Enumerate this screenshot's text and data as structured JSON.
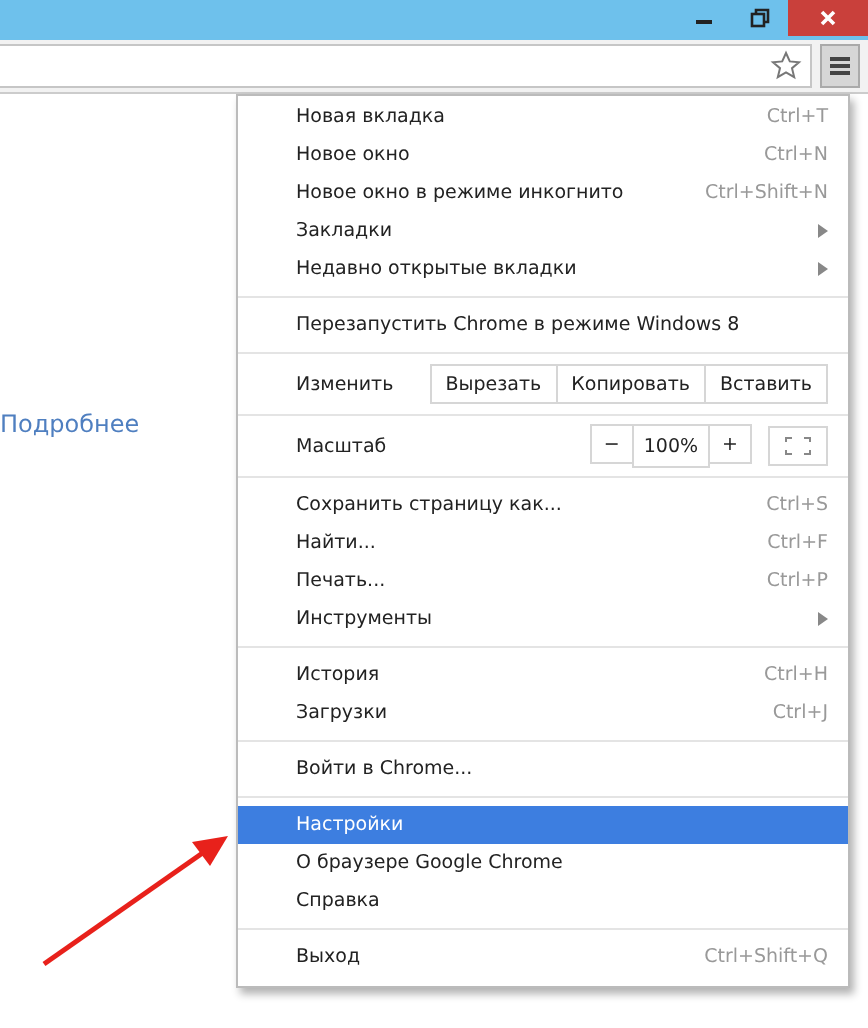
{
  "page": {
    "link": "Подробнее"
  },
  "menu": {
    "sections": [
      [
        {
          "kind": "item",
          "label": "Новая вкладка",
          "shortcut": "Ctrl+T",
          "submenu": false,
          "selected": false
        },
        {
          "kind": "item",
          "label": "Новое окно",
          "shortcut": "Ctrl+N",
          "submenu": false,
          "selected": false
        },
        {
          "kind": "item",
          "label": "Новое окно в режиме инкогнито",
          "shortcut": "Ctrl+Shift+N",
          "submenu": false,
          "selected": false
        },
        {
          "kind": "item",
          "label": "Закладки",
          "submenu": true,
          "selected": false
        },
        {
          "kind": "item",
          "label": "Недавно открытые вкладки",
          "submenu": true,
          "selected": false
        }
      ],
      [
        {
          "kind": "item",
          "label": "Перезапустить Chrome в режиме Windows 8",
          "submenu": false,
          "selected": false
        }
      ],
      [
        {
          "kind": "edit",
          "label": "Изменить",
          "buttons": [
            "Вырезать",
            "Копировать",
            "Вставить"
          ]
        }
      ],
      [
        {
          "kind": "zoom",
          "label": "Масштаб",
          "minus": "−",
          "value": "100%",
          "plus": "+"
        }
      ],
      [
        {
          "kind": "item",
          "label": "Сохранить страницу как...",
          "shortcut": "Ctrl+S",
          "submenu": false,
          "selected": false
        },
        {
          "kind": "item",
          "label": "Найти...",
          "shortcut": "Ctrl+F",
          "submenu": false,
          "selected": false
        },
        {
          "kind": "item",
          "label": "Печать...",
          "shortcut": "Ctrl+P",
          "submenu": false,
          "selected": false
        },
        {
          "kind": "item",
          "label": "Инструменты",
          "submenu": true,
          "selected": false
        }
      ],
      [
        {
          "kind": "item",
          "label": "История",
          "shortcut": "Ctrl+H",
          "submenu": false,
          "selected": false
        },
        {
          "kind": "item",
          "label": "Загрузки",
          "shortcut": "Ctrl+J",
          "submenu": false,
          "selected": false
        }
      ],
      [
        {
          "kind": "item",
          "label": "Войти в Chrome...",
          "submenu": false,
          "selected": false
        }
      ],
      [
        {
          "kind": "item",
          "label": "Настройки",
          "submenu": false,
          "selected": true
        },
        {
          "kind": "item",
          "label": "О браузере Google Chrome",
          "submenu": false,
          "selected": false
        },
        {
          "kind": "item",
          "label": "Справка",
          "submenu": false,
          "selected": false
        }
      ],
      [
        {
          "kind": "item",
          "label": "Выход",
          "shortcut": "Ctrl+Shift+Q",
          "submenu": false,
          "selected": false
        }
      ]
    ]
  }
}
